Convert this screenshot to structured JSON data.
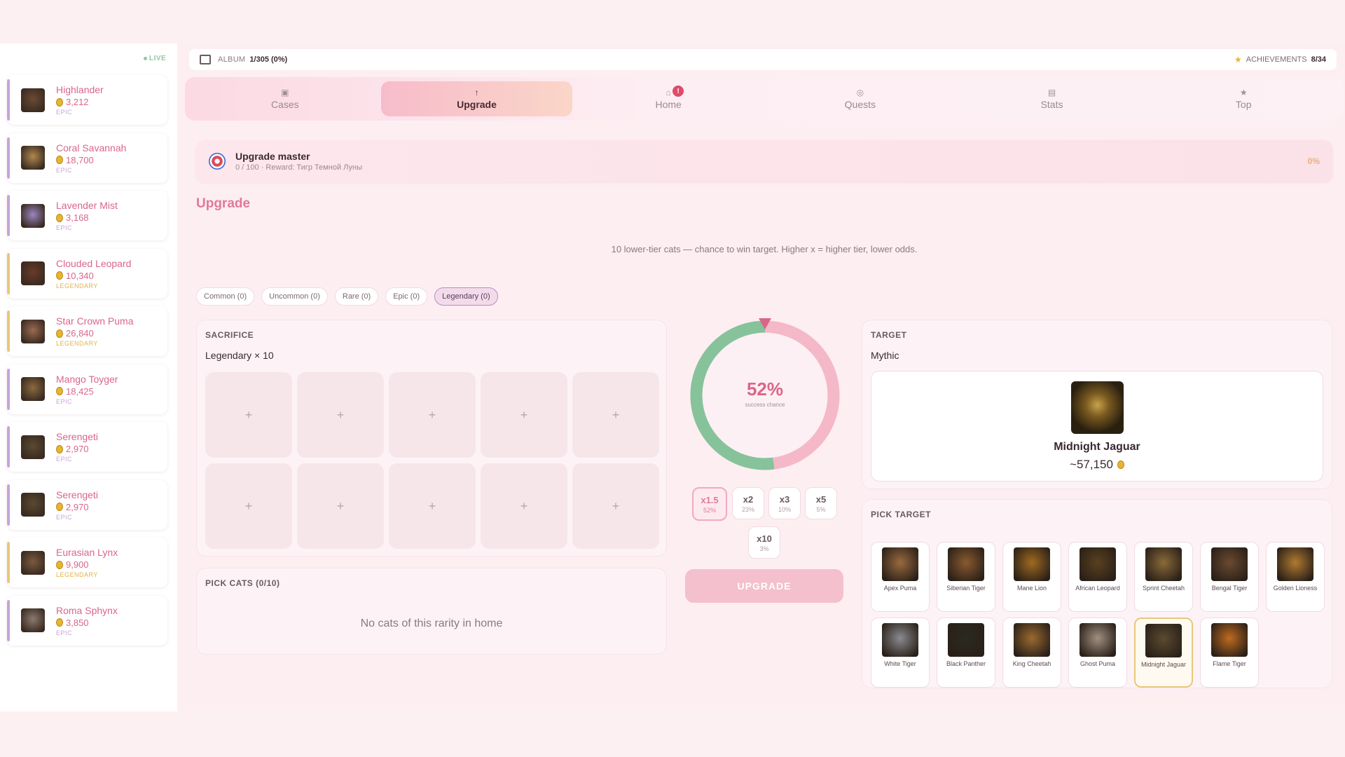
{
  "sidebar": {
    "live_label": "LIVE",
    "items": [
      {
        "name": "Highlander",
        "price": "3,212",
        "rarity": "EPIC",
        "tier": "epic",
        "color": "#6b4a36"
      },
      {
        "name": "Coral Savannah",
        "price": "18,700",
        "rarity": "EPIC",
        "tier": "epic",
        "color": "#b08850"
      },
      {
        "name": "Lavender Mist",
        "price": "3,168",
        "rarity": "EPIC",
        "tier": "epic",
        "color": "#9a86c2"
      },
      {
        "name": "Clouded Leopard",
        "price": "10,340",
        "rarity": "LEGENDARY",
        "tier": "legendary",
        "color": "#6a3a2a"
      },
      {
        "name": "Star Crown Puma",
        "price": "26,840",
        "rarity": "LEGENDARY",
        "tier": "legendary",
        "color": "#9a6a52"
      },
      {
        "name": "Mango Toyger",
        "price": "18,425",
        "rarity": "EPIC",
        "tier": "epic",
        "color": "#8a6a40"
      },
      {
        "name": "Serengeti",
        "price": "2,970",
        "rarity": "EPIC",
        "tier": "epic",
        "color": "#5a4a30"
      },
      {
        "name": "Serengeti",
        "price": "2,970",
        "rarity": "EPIC",
        "tier": "epic",
        "color": "#5a4a30"
      },
      {
        "name": "Eurasian Lynx",
        "price": "9,900",
        "rarity": "LEGENDARY",
        "tier": "legendary",
        "color": "#7a5a40"
      },
      {
        "name": "Roma Sphynx",
        "price": "3,850",
        "rarity": "EPIC",
        "tier": "epic",
        "color": "#8a7a70"
      }
    ]
  },
  "topbar": {
    "album_label": "ALBUM",
    "album_value": "1/305 (0%)",
    "achievements_label": "ACHIEVEMENTS",
    "achievements_value": "8/34"
  },
  "nav": {
    "tabs": [
      {
        "label": "Cases",
        "icon": "▣"
      },
      {
        "label": "Upgrade",
        "icon": "↑"
      },
      {
        "label": "Home",
        "icon": "⌂",
        "badge": "!"
      },
      {
        "label": "Quests",
        "icon": "◎"
      },
      {
        "label": "Stats",
        "icon": "▤"
      },
      {
        "label": "Top",
        "icon": "★"
      }
    ]
  },
  "quest": {
    "title": "Upgrade master",
    "subtitle": "0 / 100 · Reward: Тигр Темной Луны",
    "progress": "0%"
  },
  "upgrade": {
    "title": "Upgrade",
    "description": "10 lower-tier cats — chance to win target. Higher x = higher tier, lower odds.",
    "chips": [
      "Common (0)",
      "Uncommon (0)",
      "Rare (0)",
      "Epic (0)",
      "Legendary (0)"
    ],
    "active_chip": 4,
    "sacrifice_label": "SACRIFICE",
    "sacrifice_sub": "Legendary × 10",
    "slot_symbol": "+",
    "pick_label": "PICK CATS (0/10)",
    "empty_text": "No cats of this rarity in home",
    "chance": "52%",
    "chance_label": "success chance",
    "chance_fraction": 0.52,
    "multipliers": [
      {
        "m": "x1.5",
        "c": "52%"
      },
      {
        "m": "x2",
        "c": "23%"
      },
      {
        "m": "x3",
        "c": "10%"
      },
      {
        "m": "x5",
        "c": "5%"
      },
      {
        "m": "x10",
        "c": "3%"
      }
    ],
    "button": "UPGRADE"
  },
  "target": {
    "label": "TARGET",
    "tier": "Mythic",
    "name": "Midnight Jaguar",
    "price": "~57,150",
    "pick_label": "PICK TARGET",
    "cats": [
      {
        "name": "Apex Puma",
        "color": "#9a6a40"
      },
      {
        "name": "Siberian Tiger",
        "color": "#8a5a30"
      },
      {
        "name": "Mane Lion",
        "color": "#a06a20"
      },
      {
        "name": "African Leopard",
        "color": "#5a4020"
      },
      {
        "name": "Sprint Cheetah",
        "color": "#8a6a3a"
      },
      {
        "name": "Bengal Tiger",
        "color": "#6a4a30"
      },
      {
        "name": "Golden Lioness",
        "color": "#b07a30"
      },
      {
        "name": "White Tiger",
        "color": "#8a8a90"
      },
      {
        "name": "Black Panther",
        "color": "#2a2a20"
      },
      {
        "name": "King Cheetah",
        "color": "#9a6a30"
      },
      {
        "name": "Ghost Puma",
        "color": "#a09080"
      },
      {
        "name": "Midnight Jaguar",
        "color": "#5a4a30",
        "selected": true
      },
      {
        "name": "Flame Tiger",
        "color": "#c06a20"
      }
    ]
  }
}
